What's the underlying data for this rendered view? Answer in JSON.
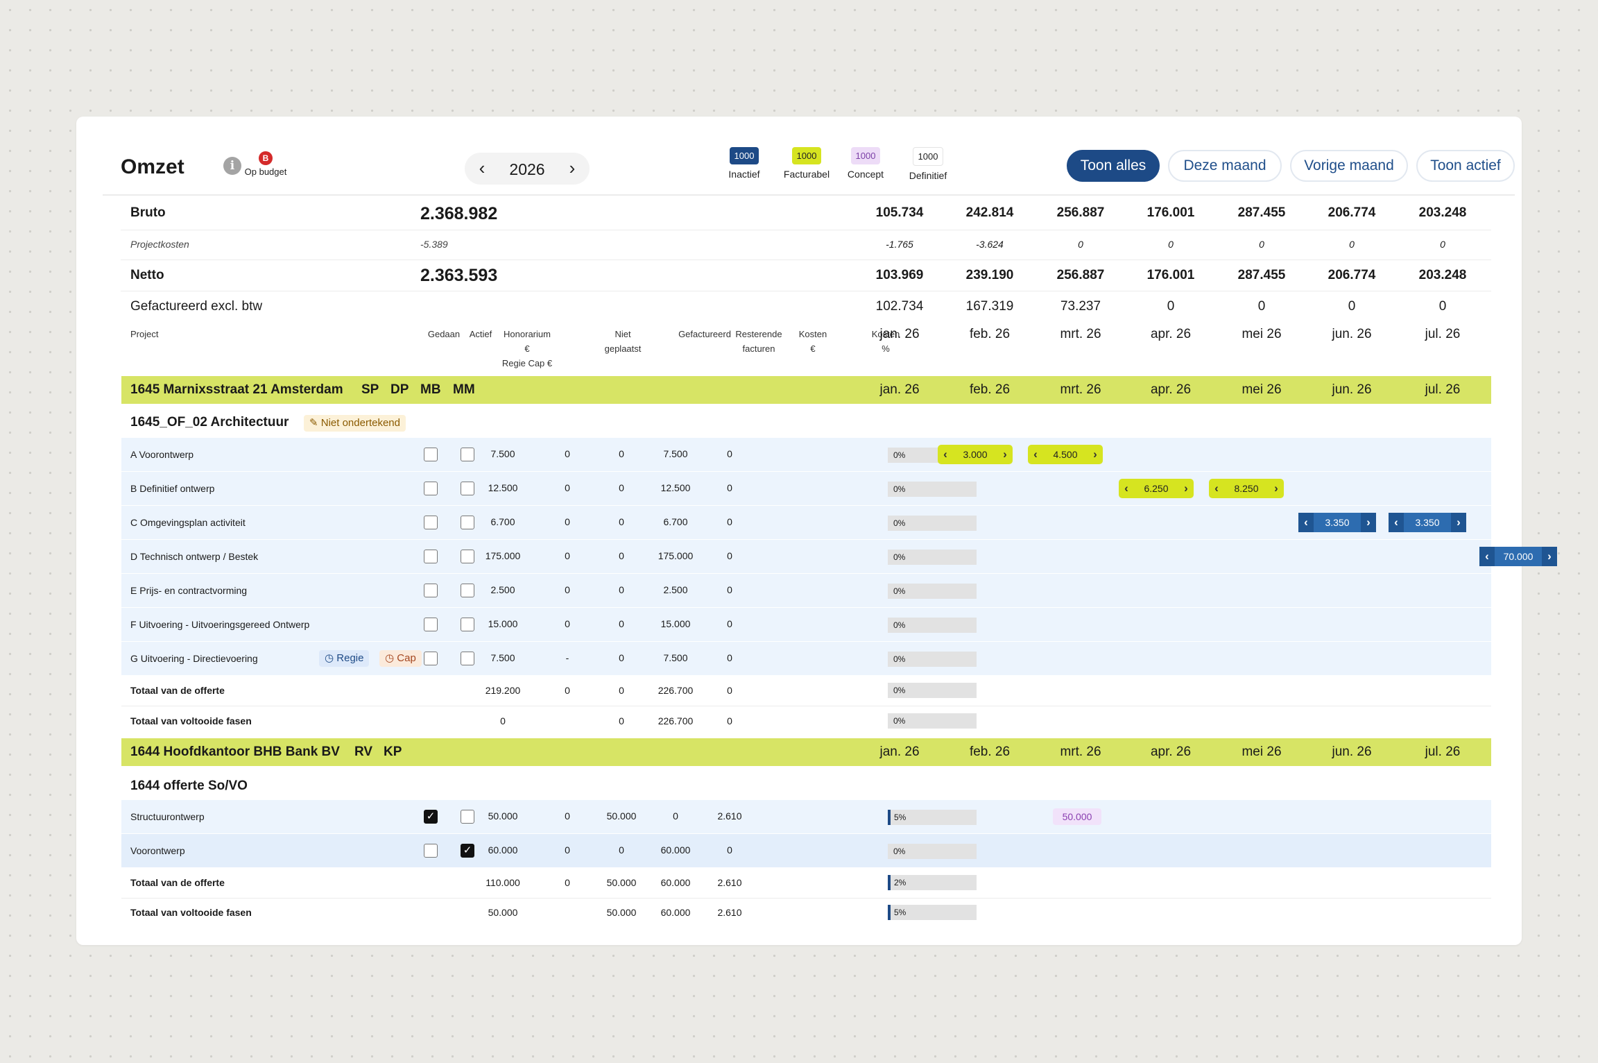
{
  "header": {
    "title": "Omzet",
    "info_icon": "i",
    "budget_badge": "B",
    "budget_label": "Op budget",
    "year": "2026",
    "prev": "‹",
    "next": "›"
  },
  "legend": [
    {
      "value": "1000",
      "label": "Inactief"
    },
    {
      "value": "1000",
      "label": "Facturabel"
    },
    {
      "value": "1000",
      "label": "Concept"
    },
    {
      "value": "1000",
      "label": "Definitief"
    }
  ],
  "filters": {
    "all": "Toon alles",
    "month": "Deze maand",
    "prev_month": "Vorige maand",
    "active": "Toon actief"
  },
  "months": [
    "jan. 26",
    "feb. 26",
    "mrt. 26",
    "apr. 26",
    "mei 26",
    "jun. 26",
    "jul. 26"
  ],
  "summary": {
    "bruto": {
      "label": "Bruto",
      "total": "2.368.982",
      "months": [
        "105.734",
        "242.814",
        "256.887",
        "176.001",
        "287.455",
        "206.774",
        "203.248"
      ]
    },
    "kosten": {
      "label": "Projectkosten",
      "total": "-5.389",
      "months": [
        "-1.765",
        "-3.624",
        "0",
        "0",
        "0",
        "0",
        "0"
      ]
    },
    "netto": {
      "label": "Netto",
      "total": "2.363.593",
      "months": [
        "103.969",
        "239.190",
        "256.887",
        "176.001",
        "287.455",
        "206.774",
        "203.248"
      ]
    },
    "gefact": {
      "label": "Gefactureerd excl. btw",
      "months": [
        "102.734",
        "167.319",
        "73.237",
        "0",
        "0",
        "0",
        "0"
      ]
    }
  },
  "columns": {
    "project": "Project",
    "gedaan": "Gedaan",
    "actief": "Actief",
    "honorarium_1": "Honorarium",
    "honorarium_2": "€",
    "honorarium_3": "Regie Cap €",
    "niet_1": "Niet",
    "niet_2": "geplaatst",
    "gefactureerd": "Gefactureerd",
    "rest_1": "Resterende",
    "rest_2": "facturen",
    "kosten_1": "Kosten",
    "kosten_2": "€",
    "kostenp_1": "Kosten",
    "kostenp_2": "%"
  },
  "project1": {
    "name": "1645 Marnixsstraat 21 Amsterdam",
    "initials": [
      "SP",
      "DP",
      "MB",
      "MM"
    ],
    "offer": "1645_OF_02 Architectuur",
    "offer_status": "Niet ondertekend",
    "phases": [
      {
        "name": "A Voorontwerp",
        "gedaan": false,
        "actief": false,
        "hon": "7.500",
        "niet": "0",
        "gef": "0",
        "rest": "7.500",
        "kosten": "0",
        "pct": "0%"
      },
      {
        "name": "B Definitief ontwerp",
        "gedaan": false,
        "actief": false,
        "hon": "12.500",
        "niet": "0",
        "gef": "0",
        "rest": "12.500",
        "kosten": "0",
        "pct": "0%"
      },
      {
        "name": "C Omgevingsplan activiteit",
        "gedaan": false,
        "actief": false,
        "hon": "6.700",
        "niet": "0",
        "gef": "0",
        "rest": "6.700",
        "kosten": "0",
        "pct": "0%"
      },
      {
        "name": "D Technisch ontwerp / Bestek",
        "gedaan": false,
        "actief": false,
        "hon": "175.000",
        "niet": "0",
        "gef": "0",
        "rest": "175.000",
        "kosten": "0",
        "pct": "0%"
      },
      {
        "name": "E Prijs- en contractvorming",
        "gedaan": false,
        "actief": false,
        "hon": "2.500",
        "niet": "0",
        "gef": "0",
        "rest": "2.500",
        "kosten": "0",
        "pct": "0%"
      },
      {
        "name": "F Uitvoering - Uitvoeringsgereed Ontwerp",
        "gedaan": false,
        "actief": false,
        "hon": "15.000",
        "niet": "0",
        "gef": "0",
        "rest": "15.000",
        "kosten": "0",
        "pct": "0%"
      },
      {
        "name": "G Uitvoering - Directievoering",
        "gedaan": false,
        "actief": false,
        "hon": "7.500",
        "niet": "-",
        "gef": "0",
        "rest": "7.500",
        "kosten": "0",
        "pct": "0%",
        "tag_regie": "Regie",
        "tag_cap": "Cap"
      }
    ],
    "total_offer": {
      "label": "Totaal van de offerte",
      "hon": "219.200",
      "niet": "0",
      "gef": "0",
      "rest": "226.700",
      "kosten": "0",
      "pct": "0%"
    },
    "total_done": {
      "label": "Totaal van voltooide fasen",
      "hon": "0",
      "gef": "0",
      "rest": "226.700",
      "kosten": "0",
      "pct": "0%"
    },
    "planned": {
      "a_jan": "3.000",
      "a_feb": "4.500",
      "b_mrt": "6.250",
      "b_apr": "8.250",
      "c_mei": "3.350",
      "c_jun": "3.350",
      "d_jul": "70.000"
    }
  },
  "project2": {
    "name": "1644 Hoofdkantoor BHB Bank BV",
    "initials": [
      "RV",
      "KP"
    ],
    "offer": "1644 offerte So/VO",
    "phases": [
      {
        "name": "Structuurontwerp",
        "gedaan": true,
        "actief": false,
        "hon": "50.000",
        "niet": "0",
        "gef": "50.000",
        "rest": "0",
        "kosten": "2.610",
        "pct": "5%"
      },
      {
        "name": "Voorontwerp",
        "gedaan": false,
        "actief": true,
        "hon": "60.000",
        "niet": "0",
        "gef": "0",
        "rest": "60.000",
        "kosten": "0",
        "pct": "0%"
      }
    ],
    "total_offer": {
      "label": "Totaal van de offerte",
      "hon": "110.000",
      "niet": "0",
      "gef": "50.000",
      "rest": "60.000",
      "kosten": "2.610",
      "pct": "2%"
    },
    "total_done": {
      "label": "Totaal van voltooide fasen",
      "hon": "50.000",
      "gef": "50.000",
      "rest": "60.000",
      "kosten": "2.610",
      "pct": "5%"
    },
    "planned": {
      "s_mrt": "50.000"
    }
  },
  "colors": {
    "band": "#d7e465",
    "primary": "#1d4a86",
    "inactief": "#1d4a86",
    "facturabel": "#d6e420",
    "concept": "#eddcf7",
    "danger": "#d42a2a"
  }
}
